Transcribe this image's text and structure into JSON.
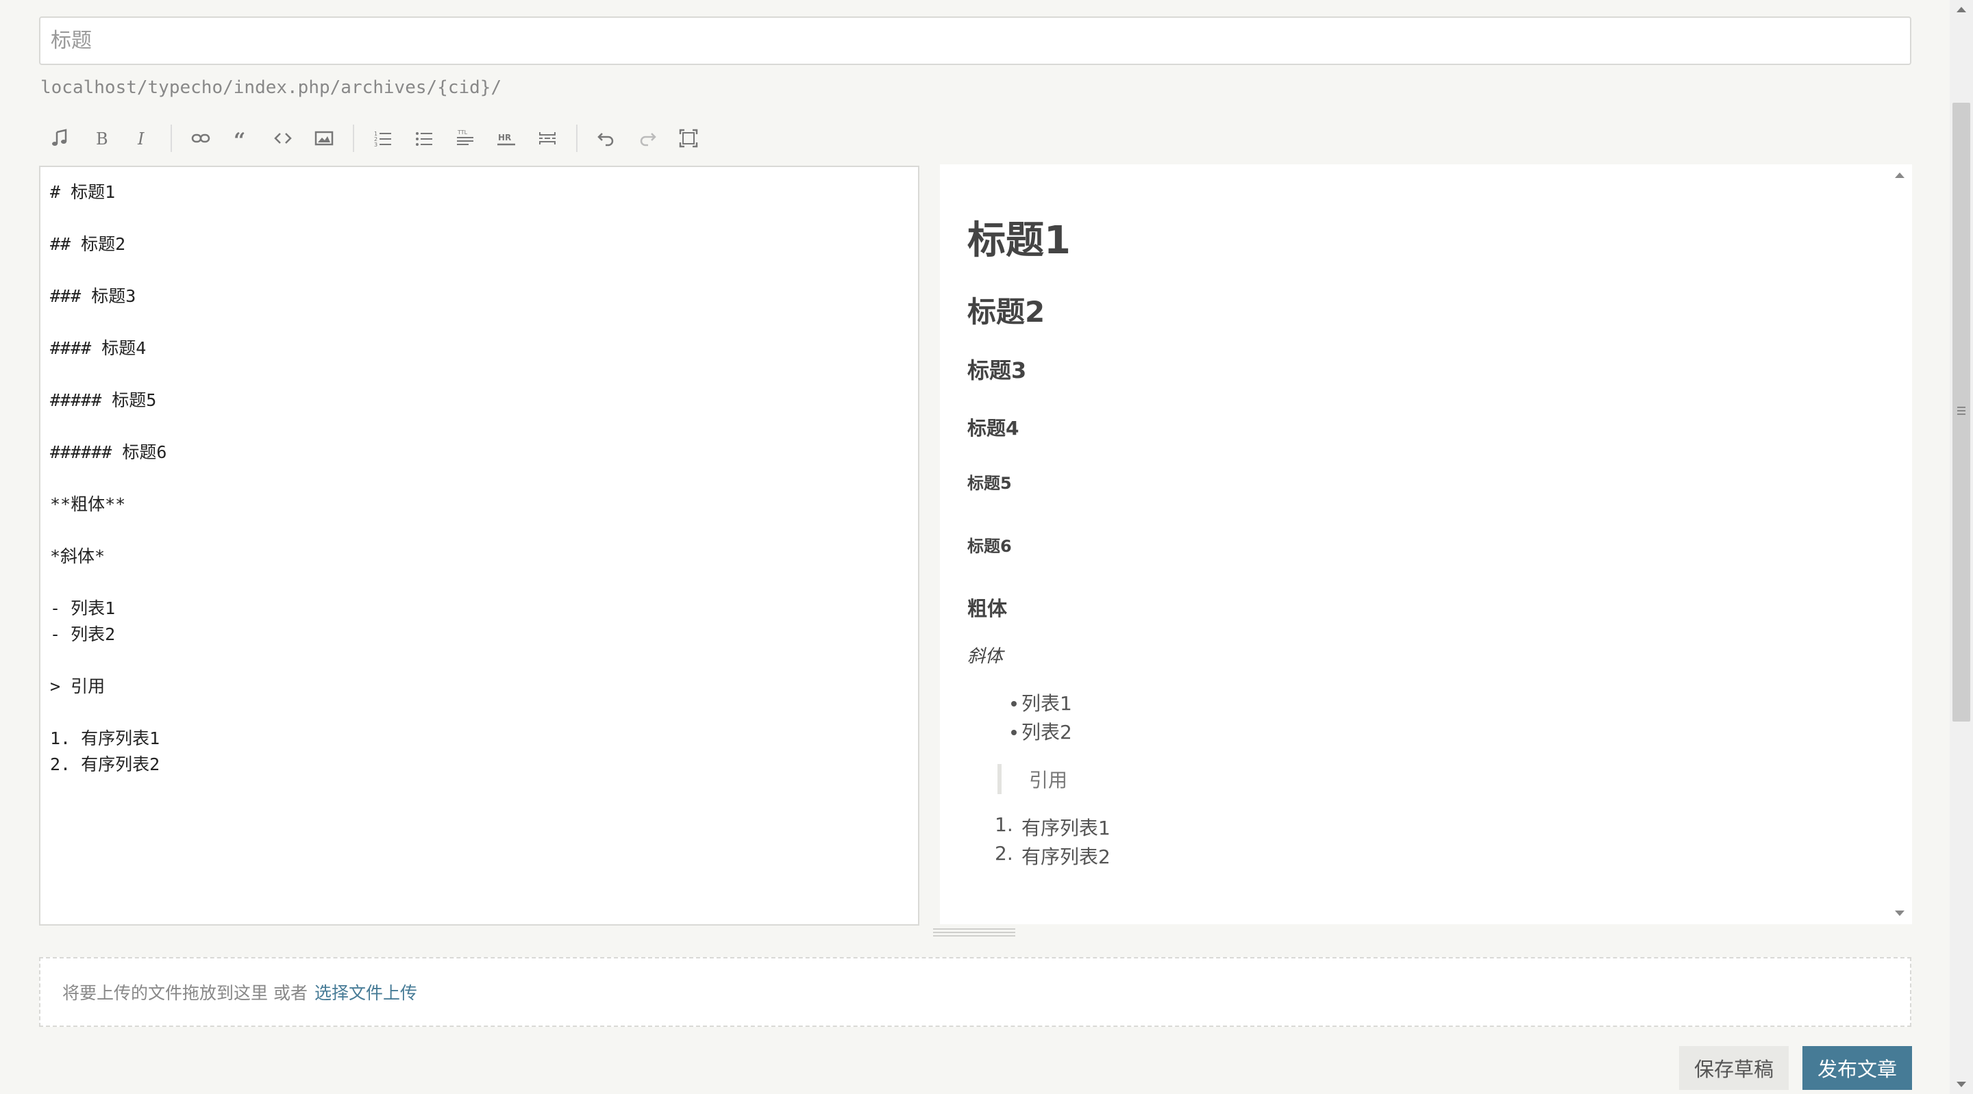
{
  "title_input": {
    "placeholder": "标题",
    "value": ""
  },
  "permalink": "localhost/typecho/index.php/archives/{cid}/",
  "toolbar": {
    "groups": [
      [
        "music-icon",
        "bold-icon",
        "italic-icon"
      ],
      [
        "link-icon",
        "quote-icon",
        "code-icon",
        "image-icon"
      ],
      [
        "ordered-list-icon",
        "unordered-list-icon",
        "heading-icon",
        "hr-icon",
        "more-break-icon"
      ],
      [
        "undo-icon",
        "redo-icon",
        "fullscreen-icon"
      ]
    ]
  },
  "editor": {
    "lines": [
      "# 标题1",
      "",
      "## 标题2",
      "",
      "### 标题3",
      "",
      "#### 标题4",
      "",
      "##### 标题5",
      "",
      "###### 标题6",
      "",
      "**粗体**",
      "",
      "*斜体*",
      "",
      "- 列表1",
      "- 列表2",
      "",
      "> 引用",
      "",
      "1. 有序列表1",
      "2. 有序列表2"
    ]
  },
  "preview": {
    "h1": "标题1",
    "h2": "标题2",
    "h3": "标题3",
    "h4": "标题4",
    "h5": "标题5",
    "h6": "标题6",
    "bold": "粗体",
    "italic": "斜体",
    "list": [
      "列表1",
      "列表2"
    ],
    "quote": "引用",
    "ordered": [
      {
        "num": "1.",
        "text": "有序列表1"
      },
      {
        "num": "2.",
        "text": "有序列表2"
      }
    ]
  },
  "upload": {
    "hint": "将要上传的文件拖放到这里 或者",
    "link": "选择文件上传"
  },
  "buttons": {
    "save_draft": "保存草稿",
    "publish": "发布文章"
  },
  "colors": {
    "accent": "#467b96",
    "background": "#f6f6f3",
    "border": "#d9d9d6"
  }
}
